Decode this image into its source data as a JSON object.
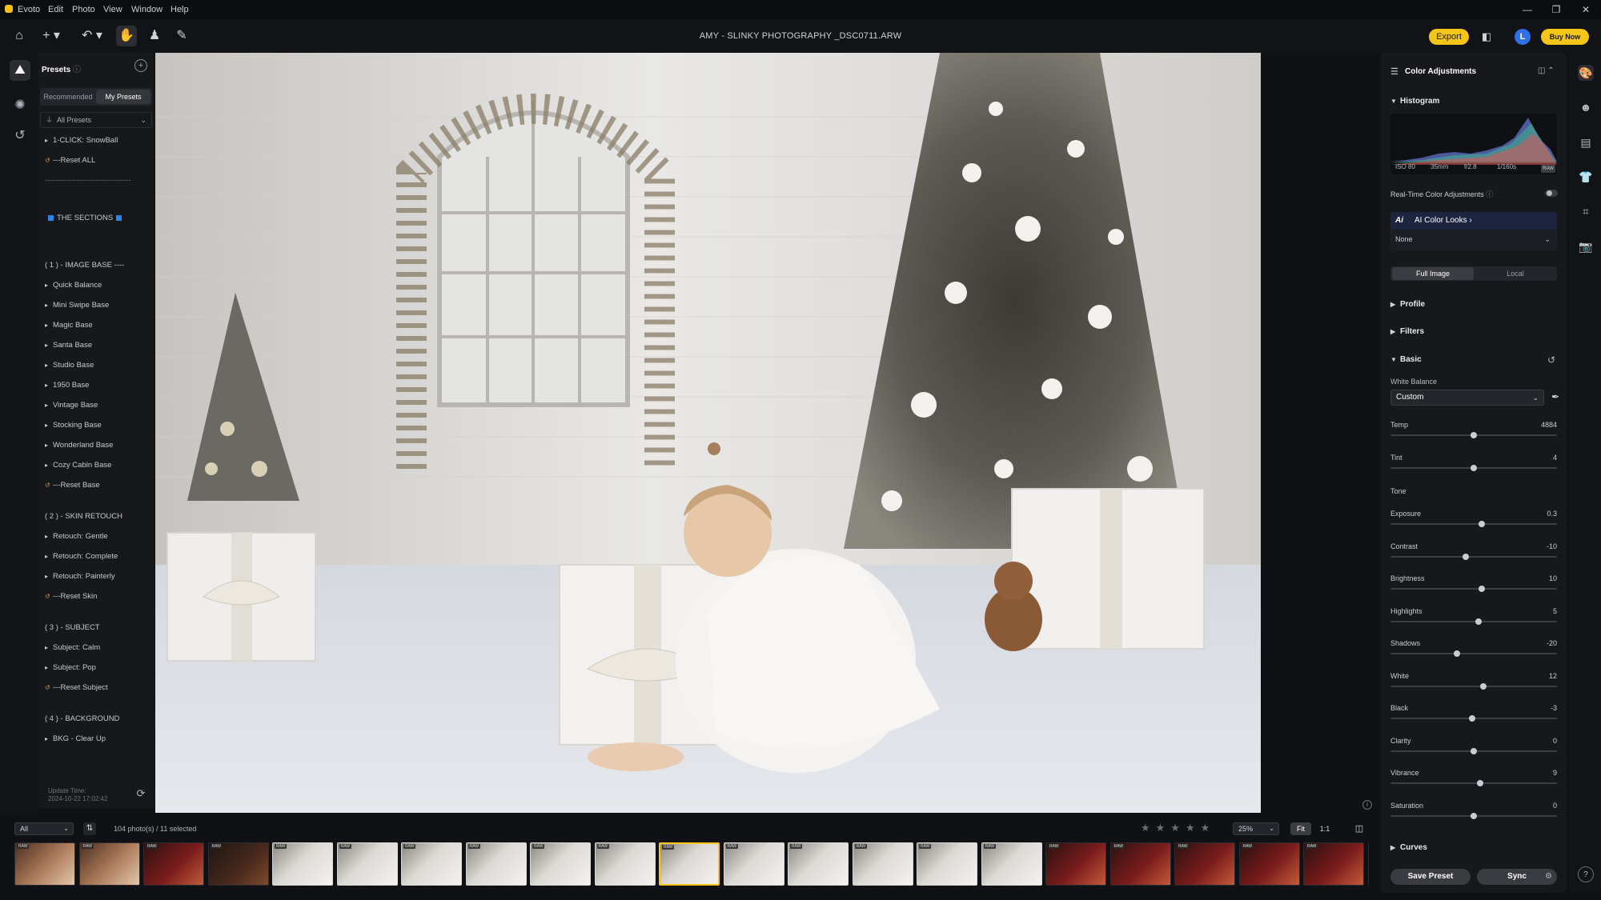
{
  "menubar": {
    "app_name": "Evoto",
    "items": [
      "Edit",
      "Photo",
      "View",
      "Window",
      "Help"
    ]
  },
  "toolbar": {
    "document_title": "AMY - SLINKY PHOTOGRAPHY _DSC0711.ARW",
    "export_label": "Export",
    "avatar_letter": "L",
    "buy_label": "Buy Now"
  },
  "presets": {
    "title": "Presets",
    "tabs": [
      "Recommended",
      "My Presets"
    ],
    "active_tab": "My Presets",
    "filter_label": "All Presets",
    "items": [
      {
        "label": "1-CLICK: SnowBall",
        "kind": "folder"
      },
      {
        "label": "---Reset ALL",
        "kind": "reset"
      },
      {
        "label": "----------------------------------",
        "kind": "divider"
      },
      {
        "label": "THE SECTIONS",
        "kind": "section"
      },
      {
        "label": "( 1 ) - IMAGE BASE ----",
        "kind": "heading"
      },
      {
        "label": "Quick Balance",
        "kind": "folder"
      },
      {
        "label": "Mini Swipe Base",
        "kind": "folder"
      },
      {
        "label": "Magic Base",
        "kind": "folder"
      },
      {
        "label": "Santa Base",
        "kind": "folder"
      },
      {
        "label": "Studio Base",
        "kind": "folder"
      },
      {
        "label": "1950 Base",
        "kind": "folder"
      },
      {
        "label": "Vintage Base",
        "kind": "folder"
      },
      {
        "label": "Stocking Base",
        "kind": "folder"
      },
      {
        "label": "Wonderland Base",
        "kind": "folder"
      },
      {
        "label": "Cozy Cabin Base",
        "kind": "folder"
      },
      {
        "label": "---Reset Base",
        "kind": "reset"
      },
      {
        "label": "( 2 ) - SKIN RETOUCH",
        "kind": "heading"
      },
      {
        "label": "Retouch: Gentle",
        "kind": "folder"
      },
      {
        "label": "Retouch: Complete",
        "kind": "folder"
      },
      {
        "label": "Retouch: Painterly",
        "kind": "folder"
      },
      {
        "label": "---Reset Skin",
        "kind": "reset"
      },
      {
        "label": "( 3 ) - SUBJECT",
        "kind": "heading"
      },
      {
        "label": "Subject: Calm",
        "kind": "folder"
      },
      {
        "label": "Subject: Pop",
        "kind": "folder"
      },
      {
        "label": "---Reset Subject",
        "kind": "reset"
      },
      {
        "label": "( 4 ) - BACKGROUND",
        "kind": "heading"
      },
      {
        "label": "BKG - Clear Up",
        "kind": "folder"
      }
    ],
    "update_time_label": "Update Time:",
    "update_time_value": "2024-10-22 17:02:42"
  },
  "color_adjustments": {
    "title": "Color Adjustments",
    "histogram_title": "Histogram",
    "histogram_meta": [
      "ISO 80",
      "35mm",
      "f/2.8",
      "1/160s"
    ],
    "raw_badge": "RAW",
    "realtime_label": "Real-Time Color Adjustments",
    "realtime_on": false,
    "ai_looks_label": "AI Color Looks",
    "ai_looks_value": "None",
    "scope_tabs": [
      "Full Image",
      "Local"
    ],
    "active_scope": "Full Image",
    "sections": {
      "profile": "Profile",
      "filters": "Filters",
      "basic": "Basic",
      "curves": "Curves"
    },
    "white_balance_label": "White Balance",
    "white_balance_value": "Custom",
    "tone_label": "Tone",
    "wb_sliders": [
      {
        "label": "Temp",
        "value": "4884",
        "position": 0.5
      },
      {
        "label": "Tint",
        "value": "4",
        "position": 0.5
      }
    ],
    "tone_sliders": [
      {
        "label": "Exposure",
        "value": "0.3",
        "position": 0.55
      },
      {
        "label": "Contrast",
        "value": "-10",
        "position": 0.45
      },
      {
        "label": "Brightness",
        "value": "10",
        "position": 0.55
      },
      {
        "label": "Highlights",
        "value": "5",
        "position": 0.53
      },
      {
        "label": "Shadows",
        "value": "-20",
        "position": 0.4
      },
      {
        "label": "White",
        "value": "12",
        "position": 0.56
      },
      {
        "label": "Black",
        "value": "-3",
        "position": 0.49
      },
      {
        "label": "Clarity",
        "value": "0",
        "position": 0.5
      },
      {
        "label": "Vibrance",
        "value": "9",
        "position": 0.54
      },
      {
        "label": "Saturation",
        "value": "0",
        "position": 0.5
      }
    ],
    "save_preset_label": "Save Preset",
    "sync_label": "Sync"
  },
  "filmstrip": {
    "filter_value": "All",
    "count_text": "104 photo(s) / 11 selected",
    "stars": "★★★★★",
    "zoom_value": "25%",
    "fit_label": "Fit",
    "one_to_one_label": "1:1",
    "thumbs": [
      {
        "tone": "warm",
        "raw": true,
        "selected": false
      },
      {
        "tone": "warm",
        "raw": true,
        "selected": false
      },
      {
        "tone": "red",
        "raw": true,
        "selected": false
      },
      {
        "tone": "dark",
        "raw": true,
        "selected": false
      },
      {
        "tone": "white",
        "raw": true,
        "selected": true
      },
      {
        "tone": "white",
        "raw": true,
        "selected": true
      },
      {
        "tone": "white",
        "raw": true,
        "selected": true
      },
      {
        "tone": "white",
        "raw": true,
        "selected": true
      },
      {
        "tone": "white",
        "raw": true,
        "selected": true
      },
      {
        "tone": "white",
        "raw": true,
        "selected": true
      },
      {
        "tone": "white",
        "raw": true,
        "selected": true,
        "current": true
      },
      {
        "tone": "white",
        "raw": true,
        "selected": true
      },
      {
        "tone": "white",
        "raw": true,
        "selected": true
      },
      {
        "tone": "white",
        "raw": true,
        "selected": true
      },
      {
        "tone": "white",
        "raw": true,
        "selected": true
      },
      {
        "tone": "white",
        "raw": true,
        "selected": true
      },
      {
        "tone": "red",
        "raw": true,
        "selected": false
      },
      {
        "tone": "red",
        "raw": true,
        "selected": false
      },
      {
        "tone": "red",
        "raw": true,
        "selected": false
      },
      {
        "tone": "red",
        "raw": true,
        "selected": false
      },
      {
        "tone": "red",
        "raw": true,
        "selected": false
      },
      {
        "tone": "red",
        "raw": true,
        "selected": false
      }
    ]
  },
  "colors": {
    "accent": "#f5c518",
    "avatar": "#2f6fe8",
    "bg": "#101114",
    "panel": "#17181c"
  }
}
